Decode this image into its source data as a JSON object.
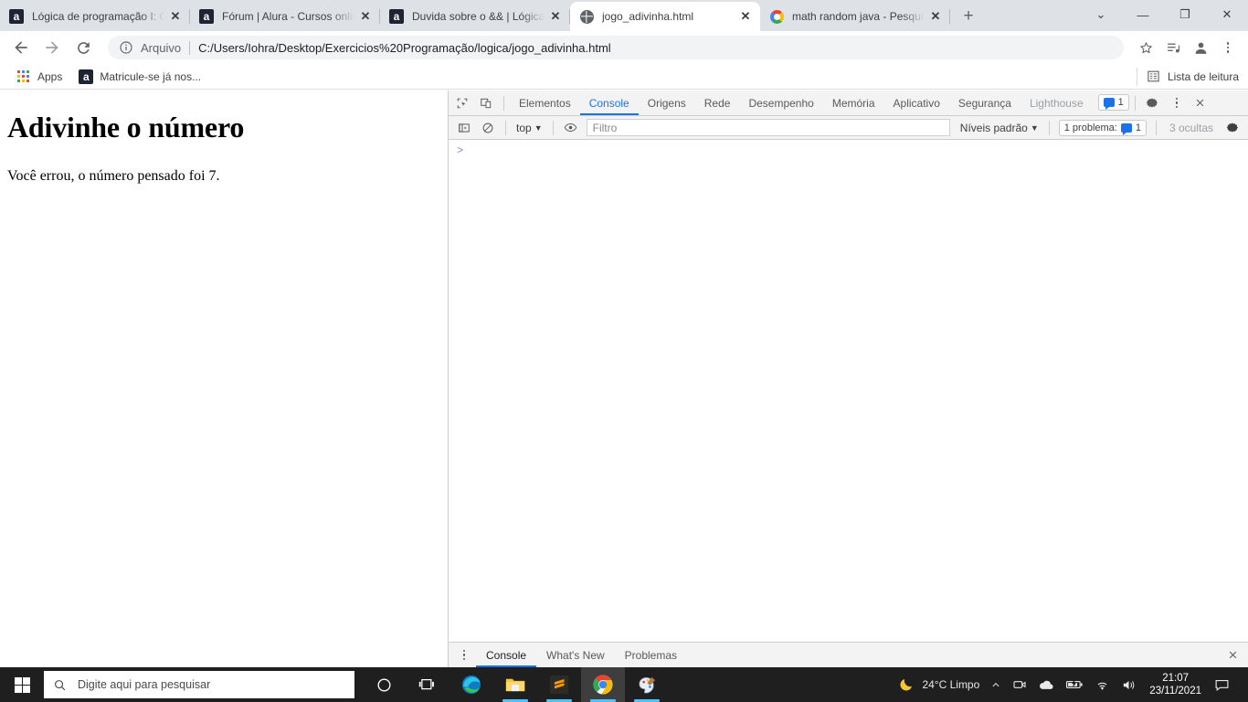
{
  "browser": {
    "tabs": [
      {
        "title": "Lógica de programação I: Os",
        "favicon": "alura-icon",
        "active": false
      },
      {
        "title": "Fórum | Alura - Cursos online",
        "favicon": "alura-icon",
        "active": false
      },
      {
        "title": "Duvida sobre o && | Lógica d",
        "favicon": "alura-icon",
        "active": false
      },
      {
        "title": "jogo_adivinha.html",
        "favicon": "globe-icon",
        "active": true
      },
      {
        "title": "math random java - Pesquisa",
        "favicon": "google-icon",
        "active": false
      }
    ],
    "new_tab_label": "+",
    "close_label": "✕",
    "window_controls": {
      "list_all_tabs": "⌄",
      "minimize": "—",
      "maximize": "❐",
      "close": "✕"
    },
    "toolbar": {
      "back": "←",
      "forward": "→",
      "reload": "⟳",
      "omnibox_scheme_label": "Arquivo",
      "omnibox_url": "C:/Users/Iohra/Desktop/Exercicios%20Programação/logica/jogo_adivinha.html",
      "bookmark_star": "☆",
      "reading_list_button": "≡♪",
      "profile_button": "account-circle",
      "menu_button": "⋮"
    },
    "bookmarks": {
      "apps_label": "Apps",
      "items": [
        {
          "label": "Matricule-se já nos...",
          "favicon": "alura-icon"
        }
      ],
      "reading_list_label": "Lista de leitura"
    }
  },
  "page": {
    "heading": "Adivinhe o número",
    "paragraph": "Você errou, o número pensado foi 7."
  },
  "devtools": {
    "inspect_icon": "inspect-element-icon",
    "device_toolbar_icon": "device-toolbar-icon",
    "tabs": [
      {
        "label": "Elementos",
        "selected": false,
        "dim": false
      },
      {
        "label": "Console",
        "selected": true,
        "dim": false
      },
      {
        "label": "Origens",
        "selected": false,
        "dim": false
      },
      {
        "label": "Rede",
        "selected": false,
        "dim": false
      },
      {
        "label": "Desempenho",
        "selected": false,
        "dim": false
      },
      {
        "label": "Memória",
        "selected": false,
        "dim": false
      },
      {
        "label": "Aplicativo",
        "selected": false,
        "dim": false
      },
      {
        "label": "Segurança",
        "selected": false,
        "dim": false
      },
      {
        "label": "Lighthouse",
        "selected": false,
        "dim": true
      }
    ],
    "issues_badge_count": "1",
    "settings_icon": "gear-icon",
    "more_options_icon": "more-vertical-icon",
    "close_icon": "close-icon",
    "console_toolbar": {
      "sidebar_toggle": "console-sidebar-icon",
      "clear_console": "clear-console-icon",
      "context_selector": "top",
      "context_caret": "▼",
      "live_expression": "eye-icon",
      "filter_placeholder": "Filtro",
      "levels_label": "Níveis padrão",
      "levels_caret": "▼",
      "issues_label": "1 problema:",
      "issues_count": "1",
      "hidden_label": "3 ocultas",
      "console_settings": "gear-icon"
    },
    "console_prompt": ">",
    "drawer": {
      "more_icon": "more-vertical-icon",
      "tabs": [
        {
          "label": "Console",
          "selected": true
        },
        {
          "label": "What's New",
          "selected": false
        },
        {
          "label": "Problemas",
          "selected": false
        }
      ],
      "close_icon": "close-icon"
    },
    "accent_color": "#1a73e8"
  },
  "taskbar": {
    "start_label": "windows-logo",
    "search_placeholder": "Digite aqui para pesquisar",
    "apps": [
      {
        "name": "cortana-icon",
        "running": false,
        "active": false
      },
      {
        "name": "task-view-icon",
        "running": false,
        "active": false
      },
      {
        "name": "microsoft-edge-icon",
        "running": false,
        "active": false
      },
      {
        "name": "file-explorer-icon",
        "running": true,
        "active": false
      },
      {
        "name": "sublime-text-icon",
        "running": true,
        "active": false
      },
      {
        "name": "google-chrome-icon",
        "running": true,
        "active": true
      },
      {
        "name": "paint-icon",
        "running": true,
        "active": false
      }
    ],
    "tray": {
      "weather_icon": "moon-icon",
      "weather_text": "24°C  Limpo",
      "chevron": "^",
      "icons": [
        "webcam-icon",
        "onedrive-icon",
        "battery-icon",
        "wifi-icon",
        "volume-icon"
      ],
      "time": "21:07",
      "date": "23/11/2021",
      "action_center": "notification-icon"
    }
  }
}
